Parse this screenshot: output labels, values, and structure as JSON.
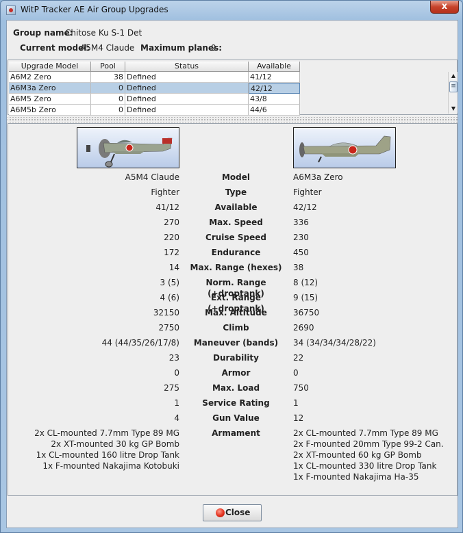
{
  "window": {
    "title": "WitP Tracker AE Air Group Upgrades",
    "close_glyph": "x"
  },
  "header": {
    "group_name_label": "Group name:",
    "group_name": "Chitose Ku S-1 Det",
    "current_model_label": "Current model:",
    "current_model": "A5M4 Claude",
    "max_planes_label": "Maximum planes:",
    "max_planes": "9"
  },
  "upgrade_table": {
    "columns": [
      "Upgrade Model",
      "Pool",
      "Status",
      "Available"
    ],
    "rows": [
      {
        "model": "A6M2 Zero",
        "pool": "38",
        "status": "Defined",
        "available": "41/12",
        "selected": false
      },
      {
        "model": "A6M3a Zero",
        "pool": "0",
        "status": "Defined",
        "available": "42/12",
        "selected": true
      },
      {
        "model": "A6M5 Zero",
        "pool": "0",
        "status": "Defined",
        "available": "43/8",
        "selected": false
      },
      {
        "model": "A6M5b Zero",
        "pool": "0",
        "status": "Defined",
        "available": "44/6",
        "selected": false
      }
    ],
    "scroll": {
      "up_glyph": "▲",
      "down_glyph": "▼",
      "thumb_glyph": "≡"
    }
  },
  "comparison": {
    "left_plane_icon": "a5m4-claude-profile-icon",
    "right_plane_icon": "a6m3a-zero-profile-icon",
    "rows": [
      {
        "label": "Model",
        "left": "A5M4 Claude",
        "right": "A6M3a Zero"
      },
      {
        "label": "Type",
        "left": "Fighter",
        "right": "Fighter"
      },
      {
        "label": "Available",
        "left": "41/12",
        "right": "42/12"
      },
      {
        "label": "Max. Speed",
        "left": "270",
        "right": "336"
      },
      {
        "label": "Cruise Speed",
        "left": "220",
        "right": "230"
      },
      {
        "label": "Endurance",
        "left": "172",
        "right": "450"
      },
      {
        "label": "Max. Range (hexes)",
        "left": "14",
        "right": "38"
      },
      {
        "label": "Norm. Range (+droptank)",
        "left": "3 (5)",
        "right": "8 (12)"
      },
      {
        "label": "Ext. Range (+droptank)",
        "left": "4 (6)",
        "right": "9 (15)"
      },
      {
        "label": "Max. Altitude",
        "left": "32150",
        "right": "36750"
      },
      {
        "label": "Climb",
        "left": "2750",
        "right": "2690"
      },
      {
        "label": "Maneuver (bands)",
        "left": "44 (44/35/26/17/8)",
        "right": "34 (34/34/34/28/22)"
      },
      {
        "label": "Durability",
        "left": "23",
        "right": "22"
      },
      {
        "label": "Armor",
        "left": "0",
        "right": "0"
      },
      {
        "label": "Max. Load",
        "left": "275",
        "right": "750"
      },
      {
        "label": "Service Rating",
        "left": "1",
        "right": "1"
      },
      {
        "label": "Gun Value",
        "left": "4",
        "right": "12"
      }
    ],
    "armament": {
      "label": "Armament",
      "left": [
        "2x CL-mounted 7.7mm Type 89 MG",
        "2x XT-mounted 30 kg GP Bomb",
        "1x CL-mounted 160 litre Drop Tank",
        "1x F-mounted Nakajima Kotobuki"
      ],
      "right": [
        "2x CL-mounted 7.7mm Type 89 MG",
        "2x F-mounted 20mm Type 99-2 Can.",
        "2x XT-mounted 60 kg GP Bomb",
        "1x CL-mounted 330 litre Drop Tank",
        "1x F-mounted Nakajima Ha-35"
      ]
    }
  },
  "footer": {
    "close_label": "Close",
    "close_icon": "red-circle-icon"
  }
}
